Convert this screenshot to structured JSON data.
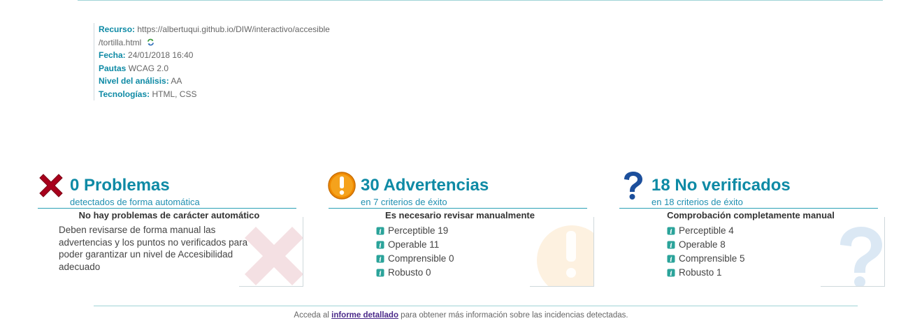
{
  "resource": {
    "label": "Recurso:",
    "url_line1": "https://albertuqui.github.io/DIW/interactivo/accesible",
    "url_line2": "/tortilla.html",
    "date_label": "Fecha:",
    "date_value": "24/01/2018 16:40",
    "guidelines_label": "Pautas",
    "guidelines_value": "WCAG 2.0",
    "level_label": "Nivel del análisis:",
    "level_value": "AA",
    "tech_label": "Tecnologías:",
    "tech_value": "HTML, CSS"
  },
  "problems": {
    "headline": "0 Problemas",
    "subline": "detectados de forma automática",
    "section_title": "No hay problemas de carácter automático",
    "description": "Deben revisarse de forma manual las advertencias y los puntos no verificados para poder garantizar un nivel de Accesibilidad adecuado",
    "color": "#a8001c"
  },
  "warnings": {
    "headline": "30 Advertencias",
    "subline": "en 7 criterios de éxito",
    "section_title": "Es necesario revisar manualmente",
    "items": [
      {
        "label": "Perceptible 19"
      },
      {
        "label": "Operable 11"
      },
      {
        "label": "Comprensible 0"
      },
      {
        "label": "Robusto 0"
      }
    ],
    "color": "#f08a00"
  },
  "unverified": {
    "headline": "18 No verificados",
    "subline": "en 18 criterios de éxito",
    "section_title": "Comprobación completamente manual",
    "items": [
      {
        "label": "Perceptible 4"
      },
      {
        "label": "Operable 8"
      },
      {
        "label": "Comprensible 5"
      },
      {
        "label": "Robusto 1"
      }
    ],
    "color": "#1c4f9c"
  },
  "footer": {
    "prefix": "Acceda al ",
    "link_text": "informe detallado",
    "suffix": " para obtener más información sobre las incidencias detectadas."
  },
  "colors": {
    "accent": "#0e8aa5",
    "rule": "#9fd3d6"
  }
}
